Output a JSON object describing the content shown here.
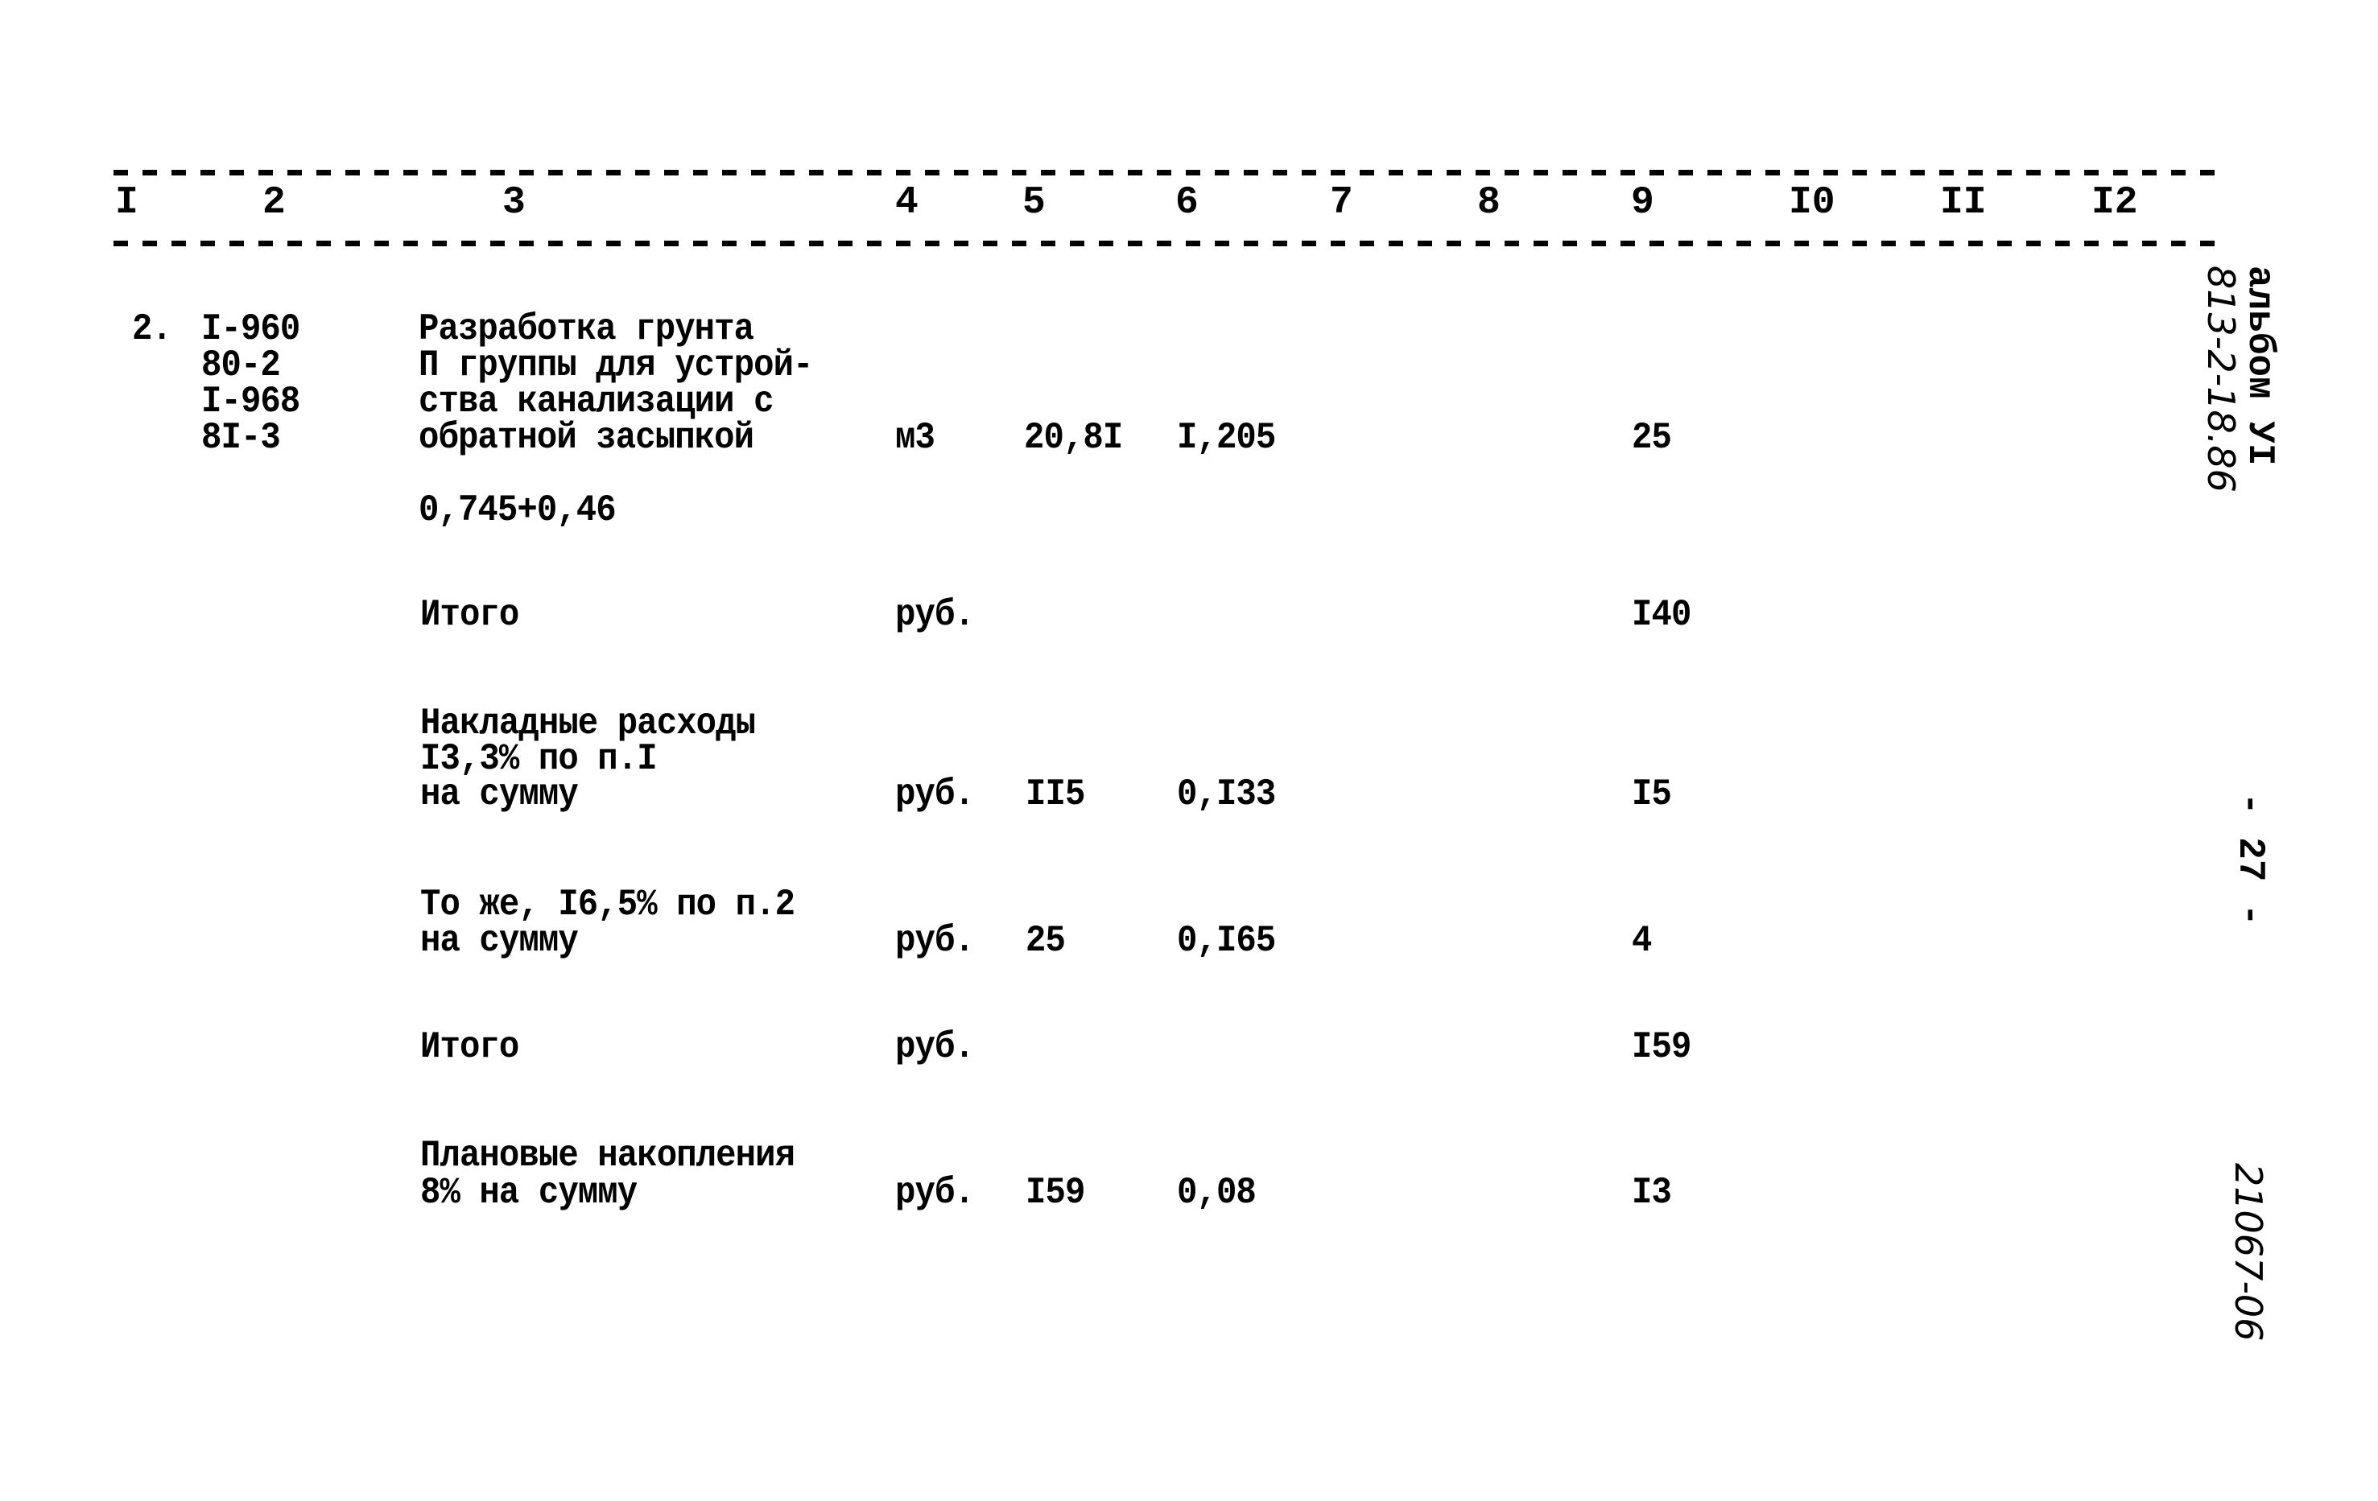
{
  "header": {
    "columns": [
      "I",
      "2",
      "3",
      "4",
      "5",
      "6",
      "7",
      "8",
      "9",
      "I0",
      "II",
      "I2"
    ]
  },
  "item": {
    "number": "2.",
    "codes": [
      "I-960",
      "80-2",
      "I-968",
      "8I-3"
    ],
    "description_lines": [
      "Разработка грунта",
      "П группы для устрой-",
      "ства канализации с",
      "обратной засыпкой"
    ],
    "unit": "м3",
    "col5": "20,8I",
    "col6": "I,205",
    "col9": "25",
    "formula": "0,745+0,46"
  },
  "rows": [
    {
      "label_lines": [
        "Итого"
      ],
      "unit": "руб.",
      "col5": "",
      "col6": "",
      "col9": "I40"
    },
    {
      "label_lines": [
        "Накладные расходы",
        "I3,3% по п.I",
        "на сумму"
      ],
      "unit": "руб.",
      "col5": "II5",
      "col6": "0,I33",
      "col9": "I5"
    },
    {
      "label_lines": [
        "То же, I6,5% по п.2",
        "на сумму"
      ],
      "unit": "руб.",
      "col5": "25",
      "col6": "0,I65",
      "col9": "4"
    },
    {
      "label_lines": [
        "Итого"
      ],
      "unit": "руб.",
      "col5": "",
      "col6": "",
      "col9": "I59"
    },
    {
      "label_lines": [
        "Плановые накопления",
        "8% на сумму"
      ],
      "unit": "руб.",
      "col5": "I59",
      "col6": "0,08",
      "col9": "I3"
    }
  ],
  "margin": {
    "album": "альбом УI",
    "album_code": "813-2-18.86",
    "page_number": "- 27 -",
    "doc_code": "21067-06"
  }
}
